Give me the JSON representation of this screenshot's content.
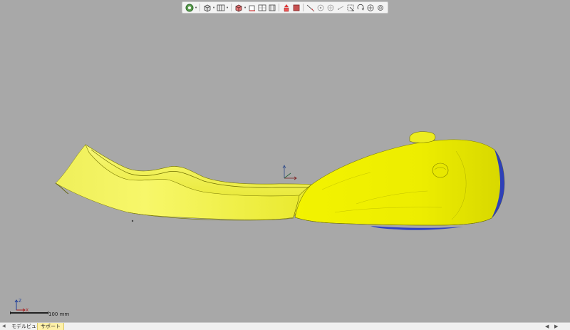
{
  "toolbar": {
    "buttons": [
      {
        "name": "fit-view-icon"
      },
      {
        "name": "cube-view-icon"
      },
      {
        "name": "multi-view-icon"
      },
      {
        "name": "shading-icon"
      },
      {
        "name": "section-icon"
      },
      {
        "name": "split-view-icon"
      },
      {
        "name": "clip-icon"
      },
      {
        "name": "color-icon"
      },
      {
        "name": "measure-icon"
      },
      {
        "name": "snap-point-icon"
      },
      {
        "name": "snap-circle-icon"
      },
      {
        "name": "snap-edge-icon"
      },
      {
        "name": "select-icon"
      },
      {
        "name": "rotate-icon"
      },
      {
        "name": "settings-icon"
      }
    ]
  },
  "scale": {
    "label": "100 mm"
  },
  "axes": {
    "x": "X",
    "y": "Y",
    "z": "Z"
  },
  "tabs": [
    {
      "label": "モデルビュー",
      "active": false
    },
    {
      "label": "サポート",
      "active": true
    }
  ],
  "colors": {
    "viewport_bg": "#a8a8a8",
    "model_yellow": "#f2f200",
    "model_blue": "#2233cc"
  }
}
